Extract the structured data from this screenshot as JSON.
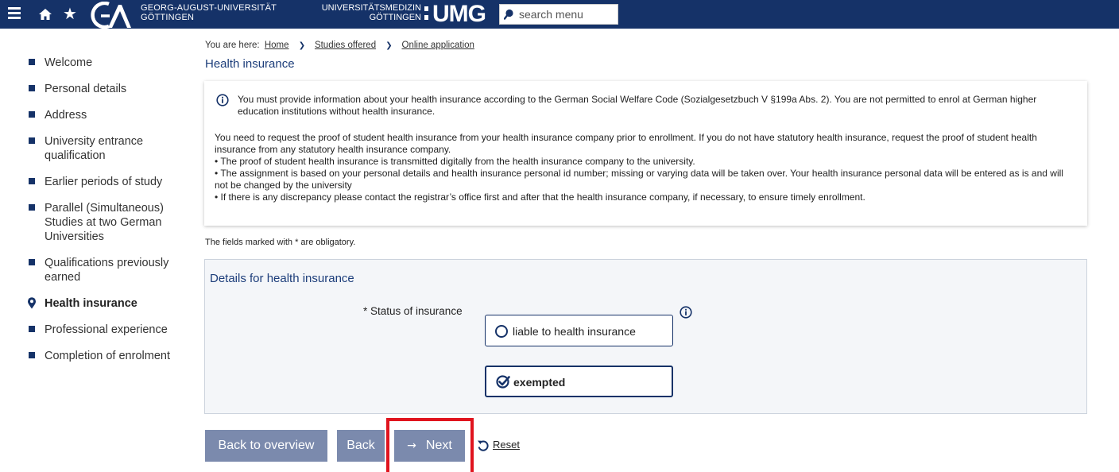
{
  "header": {
    "uni_line1": "GEORG-AUGUST-UNIVERSITÄT",
    "uni_line2": "GÖTTINGEN",
    "umg_line1": "UNIVERSITÄTSMEDIZIN",
    "umg_line2": "GÖTTINGEN",
    "umg_logo": "UMG",
    "search_placeholder": "search menu",
    "icons": [
      "menu-icon",
      "home-icon",
      "star-icon",
      "search-icon"
    ],
    "colors": {
      "bar": "#153268"
    }
  },
  "sidebar": {
    "items": [
      {
        "label": "Welcome"
      },
      {
        "label": "Personal details"
      },
      {
        "label": "Address"
      },
      {
        "label": "University entrance qualification"
      },
      {
        "label": "Earlier periods of study"
      },
      {
        "label": "Parallel (Simultaneous) Studies at two German Universities"
      },
      {
        "label": "Qualifications previously earned"
      },
      {
        "label": "Health insurance",
        "active": true
      },
      {
        "label": "Professional experience"
      },
      {
        "label": "Completion of enrolment"
      }
    ]
  },
  "breadcrumb": {
    "prefix": "You are here:",
    "items": [
      "Home",
      "Studies offered",
      "Online application"
    ]
  },
  "page": {
    "title": "Health insurance"
  },
  "info": {
    "notice": "You must provide information about your health insurance according to the German Social Welfare Code (Sozialgesetzbuch V §199a Abs. 2). You are not permitted to enrol at German higher education institutions without health insurance.",
    "paragraph": "You need to request the proof of student health insurance from your health insurance company prior to enrollment. If you do not have statutory health insurance, request the proof of student health insurance from any statutory health insurance company.",
    "bullets": [
      "• The proof of student health insurance is transmitted digitally from the health insurance company to the university.",
      "• The assignment is based on your personal details and health insurance personal id number; missing or varying data will be taken over. Your health insurance personal data will be entered as is and will not be changed by the university",
      "• If there is any discrepancy please contact the registrar’s office first and after that the health insurance company, if necessary, to ensure timely enrollment."
    ]
  },
  "form": {
    "obligatory_note": "The fields marked with * are obligatory.",
    "section_title": "Details for health insurance",
    "field_label": "* Status of insurance",
    "options": [
      {
        "label": "liable to health insurance",
        "selected": false
      },
      {
        "label": "exempted",
        "selected": true
      }
    ]
  },
  "actions": {
    "overview": "Back to overview",
    "back": "Back",
    "next": "Next",
    "reset": "Reset",
    "highlight_color": "#e0141e"
  }
}
